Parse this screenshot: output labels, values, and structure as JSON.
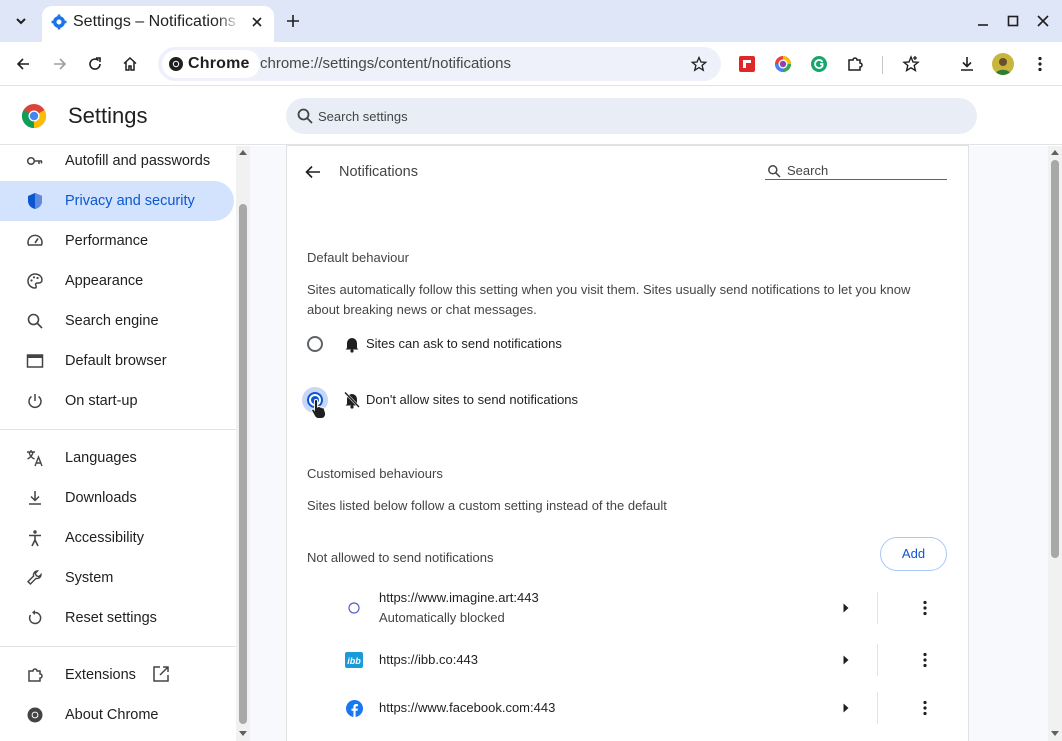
{
  "browser": {
    "tab_title": "Settings – Notifications",
    "chip_label": "Chrome",
    "url": "chrome://settings/content/notifications",
    "colors": {
      "tabstrip": "#dfe6f7",
      "accent": "#0b57d0",
      "active_nav_bg": "#d3e3fd"
    },
    "icons": [
      "tab-search-icon",
      "settings-gear-icon",
      "close-icon",
      "plus-icon",
      "minimize-icon",
      "maximize-icon",
      "window-close-icon",
      "back-arrow-icon",
      "forward-arrow-icon",
      "reload-icon",
      "home-icon",
      "chrome-icon",
      "star-icon",
      "flipboard-icon",
      "colorful-circle-icon",
      "grammarly-icon",
      "puzzle-icon",
      "bookmark-star-icon",
      "download-icon",
      "avatar",
      "more-vert-icon"
    ]
  },
  "settings": {
    "title": "Settings",
    "search_placeholder": "Search settings"
  },
  "sidebar": {
    "items": [
      {
        "label": "Autofill and passwords",
        "icon": "key-icon"
      },
      {
        "label": "Privacy and security",
        "icon": "shield-icon",
        "active": true
      },
      {
        "label": "Performance",
        "icon": "speedometer-icon"
      },
      {
        "label": "Appearance",
        "icon": "palette-icon"
      },
      {
        "label": "Search engine",
        "icon": "search-icon"
      },
      {
        "label": "Default browser",
        "icon": "browser-window-icon"
      },
      {
        "label": "On start-up",
        "icon": "power-icon"
      },
      {
        "label": "Languages",
        "icon": "translate-icon"
      },
      {
        "label": "Downloads",
        "icon": "download-icon"
      },
      {
        "label": "Accessibility",
        "icon": "accessibility-icon"
      },
      {
        "label": "System",
        "icon": "wrench-icon"
      },
      {
        "label": "Reset settings",
        "icon": "reset-icon"
      },
      {
        "label": "Extensions",
        "icon": "puzzle-icon"
      },
      {
        "label": "About Chrome",
        "icon": "chrome-icon"
      }
    ]
  },
  "notifications": {
    "page_title": "Notifications",
    "search_placeholder": "Search",
    "default_heading": "Default behaviour",
    "default_desc": "Sites automatically follow this setting when you visit them. Sites usually send notifications to let you know about breaking news or chat messages.",
    "option_ask": "Sites can ask to send notifications",
    "option_block": "Don't allow sites to send notifications",
    "selected_option": "block",
    "custom_heading": "Customised behaviours",
    "custom_desc": "Sites listed below follow a custom setting instead of the default",
    "not_allowed_label": "Not allowed to send notifications",
    "add_label": "Add",
    "sites": [
      {
        "url": "https://www.imagine.art:443",
        "sub": "Automatically blocked",
        "icon": "circle-outline-icon"
      },
      {
        "url": "https://ibb.co:443",
        "sub": "",
        "icon": "ibb-icon"
      },
      {
        "url": "https://www.facebook.com:443",
        "sub": "",
        "icon": "facebook-icon"
      }
    ]
  }
}
